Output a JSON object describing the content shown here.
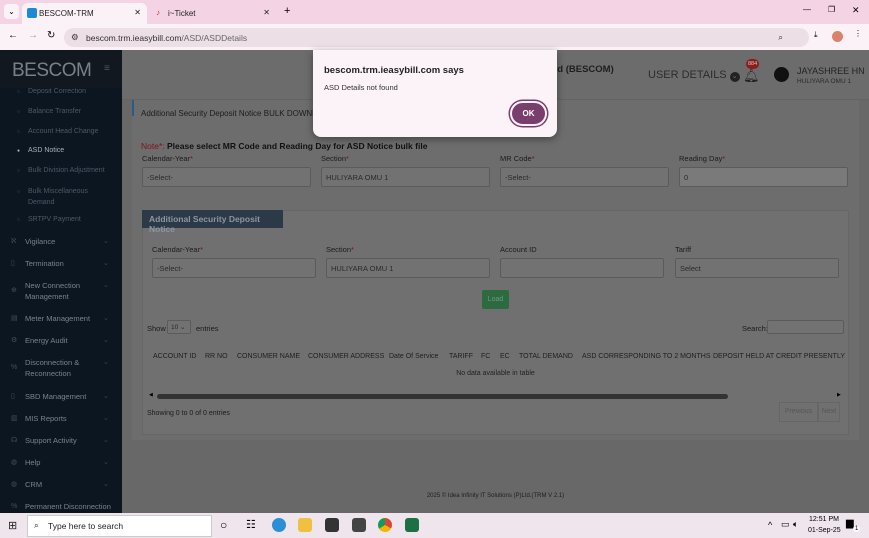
{
  "browser": {
    "tabs": [
      {
        "title": "BESCOM-TRM",
        "active": true
      },
      {
        "title": "i~Ticket",
        "active": false
      }
    ],
    "url_host": "bescom.trm.ieasybill.com",
    "url_path": "/ASD/ASDDetails"
  },
  "sidebar": {
    "logo": "BESCOM",
    "sub_items": [
      "Deposit Correction",
      "Balance Transfer",
      "Account Head Change",
      "ASD Notice",
      "Bulk Division Adjustment",
      "Bulk Miscellaneous Demand",
      "SRTPV Payment"
    ],
    "active_sub": "ASD Notice",
    "menu": [
      "Vigilance",
      "Termination",
      "New Connection Management",
      "Meter Management",
      "Energy Audit",
      "Disconnection & Reconnection",
      "SBD Management",
      "MIS Reports",
      "Support Activity",
      "Help",
      "CRM",
      "Permanent Disconnection"
    ]
  },
  "header": {
    "title": "ed (BESCOM)",
    "user_details": "USER DETAILS",
    "notif_count": "884",
    "user_name": "JAYASHREE HN",
    "user_sub": "HULIYARA OMU 1"
  },
  "bulk": {
    "title": "Additional Security Deposit Notice BULK DOWNLOAD",
    "note_prefix": "Note*:",
    "note": "Please select MR Code and Reading Day for ASD Notice bulk file",
    "fields": [
      {
        "label": "Calendar-Year",
        "value": "-Select-"
      },
      {
        "label": "Section",
        "value": "HULIYARA OMU 1"
      },
      {
        "label": "MR Code",
        "value": "-Select-"
      },
      {
        "label": "Reading Day",
        "value": "0"
      }
    ]
  },
  "asd": {
    "title": "Additional Security Deposit Notice",
    "fields": [
      {
        "label": "Calendar-Year",
        "value": "-Select-"
      },
      {
        "label": "Section",
        "value": "HULIYARA OMU 1"
      },
      {
        "label": "Account ID",
        "value": ""
      },
      {
        "label": "Tariff",
        "value": "Select"
      }
    ],
    "load": "Load",
    "show": "Show",
    "entries_value": "10",
    "entries": "entries",
    "search": "Search:",
    "columns": [
      "ACCOUNT ID",
      "RR NO",
      "CONSUMER NAME",
      "CONSUMER ADDRESS",
      "Date Of Service",
      "TARIFF",
      "FC",
      "EC",
      "TOTAL DEMAND",
      "ASD CORRESPONDING TO 2 MONTHS",
      "DEPOSIT HELD AT CREDIT PRESENTLY"
    ],
    "empty": "No data available in table",
    "info": "Showing 0 to 0 of 0 entries",
    "prev": "Previous",
    "next": "Next"
  },
  "footer": "2025 © Idea Infinity IT Solutions (P)Ltd.(TRM V 2.1)",
  "dialog": {
    "title": "bescom.trm.ieasybill.com says",
    "message": "ASD Details not found",
    "ok": "OK"
  },
  "taskbar": {
    "search": "Type here to search",
    "time": "12:51 PM",
    "date": "01-Sep-25",
    "notif": "1"
  }
}
